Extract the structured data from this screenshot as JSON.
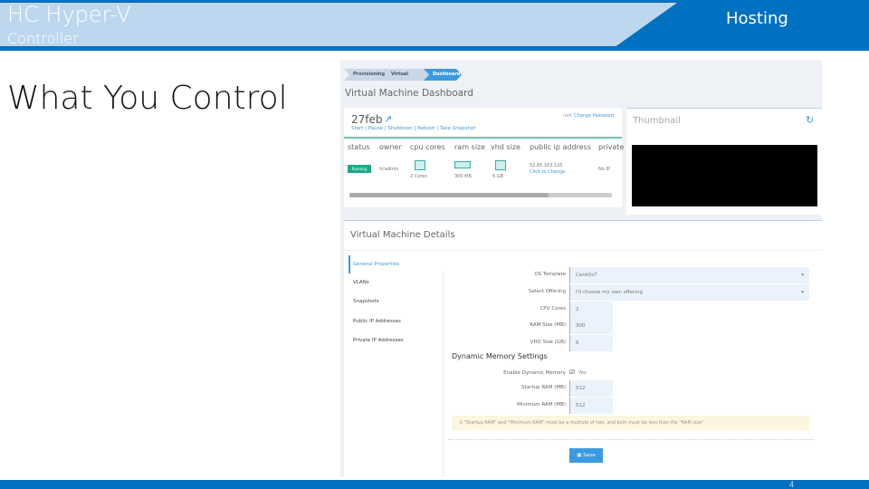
{
  "slide": {
    "title": "HC Hyper-V",
    "subtitle": "Controller",
    "section": "Hosting",
    "heading": "What You Control",
    "page_number": "4"
  },
  "app": {
    "breadcrumbs": [
      "Provisioning",
      "Virtual Machines",
      "Dashboard"
    ],
    "page_title": "Virtual Machine Dashboard",
    "vm": {
      "name": "27feb",
      "actions": "Start | Pause | Shutdown | Reboot | Take Snapshot",
      "user": "root",
      "change_password": "Change Password"
    },
    "table": {
      "headers": [
        "status",
        "owner",
        "cpu cores",
        "ram size",
        "vhd size",
        "public ip address",
        "private"
      ],
      "row": {
        "status": "Running",
        "owner": "hcadmin",
        "cpu": "2 Cores",
        "ram": "300 MB",
        "vhd": "6 GB",
        "ip": "52.65.163.125",
        "ip_link": "Click to Change",
        "private": "No IP"
      }
    },
    "thumbnail": {
      "title": "Thumbnail"
    },
    "details": {
      "title": "Virtual Machine Details",
      "nav": [
        "General Properties",
        "VLANs",
        "Snapshots",
        "Public IP Addresses",
        "Private IP Addresses"
      ],
      "fields": [
        {
          "label": "OS Template",
          "value": "CentOs7"
        },
        {
          "label": "Select Offering",
          "value": "I'll choose my own offering"
        },
        {
          "label": "CPU Cores",
          "value": "2"
        },
        {
          "label": "RAM Size (MB)",
          "value": "300"
        },
        {
          "label": "VHD Size (GB)",
          "value": "6"
        }
      ],
      "dyn_title": "Dynamic Memory Settings",
      "enable_label": "Enable Dynamic Memory",
      "enable_value": "Yes",
      "dyn_fields": [
        {
          "label": "Startup RAM (MB)",
          "value": "512"
        },
        {
          "label": "Minimum RAM (MB)",
          "value": "512"
        }
      ],
      "note": "\"Startup RAM\" and \"Minimum RAM\" must be a multiple of two, and both must be less than the \"RAM size\"",
      "save": "Save"
    }
  },
  "colors": {
    "brand": "#0070c0",
    "light": "#bdd7ee",
    "accent": "#3c9ae0",
    "running": "#1aaa88"
  }
}
